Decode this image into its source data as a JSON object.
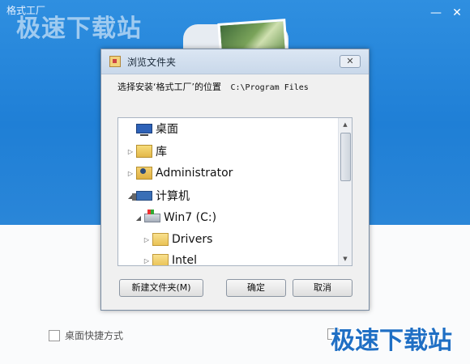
{
  "installer": {
    "app_title": "格式工厂",
    "watermark_top": "极速下载站",
    "minimize_symbol": "—",
    "close_symbol": "✕",
    "desktop_shortcut_label": "桌面快捷方式",
    "right_option_label": "",
    "watermark_bottom": "极速下载站"
  },
  "dialog": {
    "title": "浏览文件夹",
    "close_symbol": "✕",
    "prompt": "选择安装‘格式工厂’的位置",
    "path": "C:\\Program Files",
    "tree": [
      {
        "label": "桌面",
        "icon": "desktop-icon",
        "arrow": ""
      },
      {
        "label": "库",
        "icon": "library-icon",
        "arrow": "▷"
      },
      {
        "label": "Administrator",
        "icon": "user-folder-icon",
        "arrow": "▷"
      },
      {
        "label": "计算机",
        "icon": "computer-icon",
        "arrow": "◢"
      },
      {
        "label": "Win7 (C:)",
        "icon": "drive-icon",
        "arrow": "◢"
      },
      {
        "label": "Drivers",
        "icon": "folder-icon",
        "arrow": "▷"
      },
      {
        "label": "Intel",
        "icon": "folder-icon",
        "arrow": "▷"
      }
    ],
    "new_folder_button": "新建文件夹(M)",
    "ok_button": "确定",
    "cancel_button": "取消",
    "scroll_up": "▲",
    "scroll_down": "▼"
  },
  "colors": {
    "installer_blue": "#1f7fd6",
    "watermark_blue": "#1f6fc4"
  }
}
